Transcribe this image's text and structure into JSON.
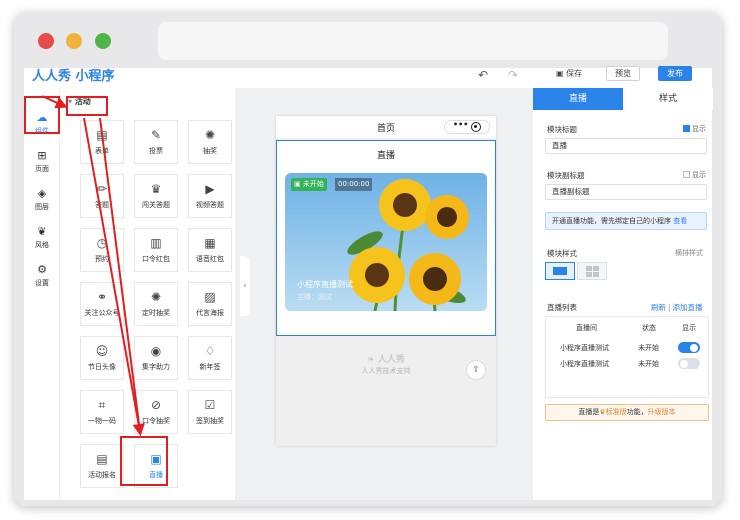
{
  "header": {
    "logo": "人人秀 小程序",
    "save_label": "保存",
    "preview_label": "预览",
    "publish_label": "发布"
  },
  "rail": {
    "items": [
      {
        "label": "组件",
        "icon": "component-icon"
      },
      {
        "label": "页面",
        "icon": "page-icon"
      },
      {
        "label": "图层",
        "icon": "layers-icon"
      },
      {
        "label": "风格",
        "icon": "style-icon"
      },
      {
        "label": "设置",
        "icon": "settings-icon"
      }
    ]
  },
  "panel": {
    "title": "活动",
    "tiles": [
      {
        "label": "表单",
        "icon": "form-icon"
      },
      {
        "label": "投票",
        "icon": "vote-icon"
      },
      {
        "label": "抽奖",
        "icon": "lottery-icon"
      },
      {
        "label": "答题",
        "icon": "quiz-icon"
      },
      {
        "label": "闯关答题",
        "icon": "trophy-icon"
      },
      {
        "label": "视频答题",
        "icon": "video-quiz-icon"
      },
      {
        "label": "预约",
        "icon": "appointment-icon"
      },
      {
        "label": "口令红包",
        "icon": "red-packet-icon"
      },
      {
        "label": "语音红包",
        "icon": "voice-red-packet-icon"
      },
      {
        "label": "关注公众号",
        "icon": "follow-icon"
      },
      {
        "label": "定时抽奖",
        "icon": "timed-lottery-icon"
      },
      {
        "label": "代言海报",
        "icon": "poster-icon"
      },
      {
        "label": "节日头像",
        "icon": "avatar-icon"
      },
      {
        "label": "集字助力",
        "icon": "collect-word-icon"
      },
      {
        "label": "新年签",
        "icon": "new-year-sign-icon"
      },
      {
        "label": "一物一码",
        "icon": "qr-code-icon"
      },
      {
        "label": "口令抽奖",
        "icon": "password-lottery-icon"
      },
      {
        "label": "签到抽奖",
        "icon": "checkin-lottery-icon"
      },
      {
        "label": "活动报名",
        "icon": "signup-icon"
      },
      {
        "label": "直播",
        "icon": "live-icon"
      }
    ]
  },
  "phone": {
    "page_title": "首页",
    "module_title": "直播",
    "badge": "未开始",
    "time": "00:00:00",
    "live_name": "小程序直播测试",
    "host": "主播：测试",
    "footer_logo": "人人秀",
    "footer_text": "人人秀技术支持"
  },
  "rpanel": {
    "tab_live": "直播",
    "tab_style": "样式",
    "module_title_label": "模块标题",
    "show_label": "显示",
    "title_value": "直播",
    "subtitle_label": "模块副标题",
    "subtitle_value": "直播副标题",
    "tip_text": "开通直播功能，需先绑定自己的小程序",
    "tip_link": "查看",
    "module_style_label": "模块样式",
    "module_style_value": "横排样式",
    "list_label": "直播列表",
    "refresh": "刷新",
    "sep": "|",
    "add_live": "添加直播",
    "col_room": "直播间",
    "col_status": "状态",
    "col_show": "显示",
    "rows": [
      {
        "room": "小程序直播测试",
        "status": "未开始",
        "shown": true
      },
      {
        "room": "小程序直播测试",
        "status": "未开始",
        "shown": false
      }
    ],
    "upgrade_a": "直播是",
    "upgrade_b": "标准版",
    "upgrade_c": "功能，",
    "upgrade_d": "升级版本"
  },
  "colors": {
    "accent": "#2a83e8",
    "highlight": "#e02020"
  }
}
